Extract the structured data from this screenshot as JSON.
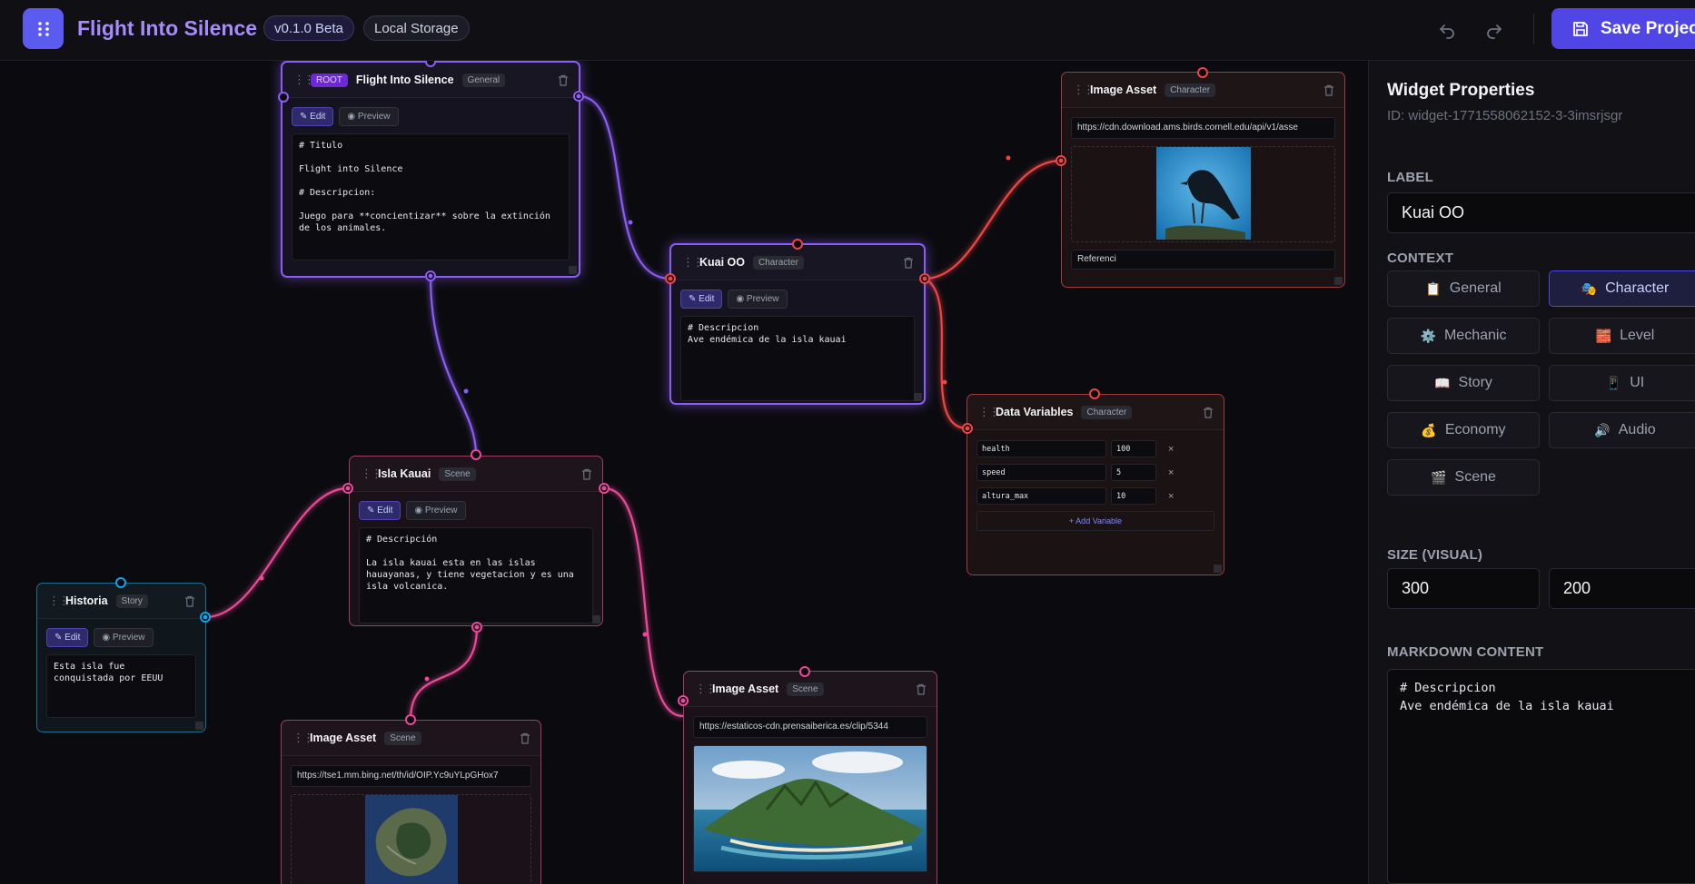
{
  "app": {
    "title": "Flight Into Silence",
    "version": "v0.1.0 Beta",
    "storage": "Local Storage",
    "save_label": "Save Project"
  },
  "nodes": {
    "root": {
      "badge": "ROOT",
      "title": "Flight Into Silence",
      "context": "General",
      "edit": "Edit",
      "preview": "Preview",
      "content": "# Titulo\n\nFlight into Silence\n\n# Descripcion:\n\nJuego para **concientizar** sobre la extinción\nde los animales."
    },
    "kuai": {
      "title": "Kuai OO",
      "context": "Character",
      "edit": "Edit",
      "preview": "Preview",
      "content": "# Descripcion\nAve endémica de la isla kauai"
    },
    "image_character": {
      "title": "Image Asset",
      "context": "Character",
      "url": "https://cdn.download.ams.birds.cornell.edu/api/v1/asse",
      "caption": "Referenci"
    },
    "data_vars": {
      "title": "Data Variables",
      "context": "Character",
      "variables": [
        {
          "key": "health",
          "value": "100"
        },
        {
          "key": "speed",
          "value": "5"
        },
        {
          "key": "altura_max",
          "value": "10"
        }
      ],
      "add_label": "+ Add Variable"
    },
    "isla": {
      "title": "Isla Kauai",
      "context": "Scene",
      "edit": "Edit",
      "preview": "Preview",
      "content": "# Descripción\n\nLa isla kauai esta en las islas\nhauayanas, y tiene vegetacion y es una\nisla volcanica."
    },
    "historia": {
      "title": "Historia",
      "context": "Story",
      "edit": "Edit",
      "preview": "Preview",
      "content": "Esta isla fue\nconquistada por EEUU"
    },
    "image_scene_1": {
      "title": "Image Asset",
      "context": "Scene",
      "url": "https://tse1.mm.bing.net/th/id/OIP.Yc9uYLpGHox7"
    },
    "image_scene_2": {
      "title": "Image Asset",
      "context": "Scene",
      "url": "https://estaticos-cdn.prensaiberica.es/clip/5344"
    }
  },
  "panel": {
    "title": "Widget Properties",
    "id": "ID: widget-1771558062152-3-3imsrjsgr",
    "label_heading": "LABEL",
    "label_value": "Kuai OO",
    "context_heading": "CONTEXT",
    "contexts": [
      {
        "label": "General",
        "icon": "clipboard-icon",
        "glyph": "📋",
        "active": false
      },
      {
        "label": "Character",
        "icon": "theater-masks-icon",
        "glyph": "🎭",
        "active": true
      },
      {
        "label": "Mechanic",
        "icon": "gear-icon",
        "glyph": "⚙️",
        "active": false
      },
      {
        "label": "Level",
        "icon": "bricks-icon",
        "glyph": "🧱",
        "active": false
      },
      {
        "label": "Story",
        "icon": "open-book-icon",
        "glyph": "📖",
        "active": false
      },
      {
        "label": "UI",
        "icon": "phone-icon",
        "glyph": "📱",
        "active": false
      },
      {
        "label": "Economy",
        "icon": "money-bag-icon",
        "glyph": "💰",
        "active": false
      },
      {
        "label": "Audio",
        "icon": "speaker-icon",
        "glyph": "🔊",
        "active": false
      },
      {
        "label": "Scene",
        "icon": "clapper-board-icon",
        "glyph": "🎬",
        "active": false
      }
    ],
    "size_heading": "SIZE (VISUAL)",
    "size_width": "300",
    "size_height": "200",
    "markdown_heading": "MARKDOWN CONTENT",
    "markdown_value": "# Descripcion\nAve endémica de la isla kauai"
  },
  "colors": {
    "accent": "#4f46e5",
    "general_wire": "#8b5cf6",
    "scene_wire": "#ec4899",
    "character_wire": "#ef4444",
    "story_wire": "#0ea5e9"
  }
}
